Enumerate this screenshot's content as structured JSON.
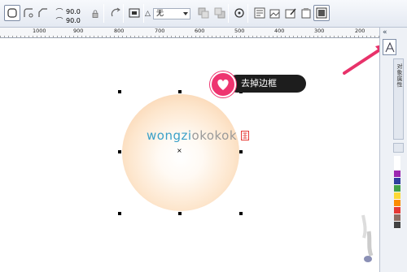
{
  "toolbar": {
    "radius_top": "90.0",
    "radius_bottom": "90.0",
    "outline_prefix": "△",
    "outline_value": "无"
  },
  "ruler": {
    "labels": [
      "1000",
      "900",
      "800",
      "700",
      "600",
      "500",
      "400",
      "300",
      "200"
    ]
  },
  "callout": {
    "text": "去掉边框"
  },
  "watermark": {
    "text_part1": "wongzi",
    "text_part2": "okokok",
    "seal_color": "#e53935"
  },
  "docker": {
    "collapse_glyph": "«",
    "tab_text": "对象属性",
    "palette": [
      "#ffffff",
      "#ffffff",
      "#9c27b0",
      "#303f9f",
      "#43a047",
      "#fdd835",
      "#fb8c00",
      "#e53935",
      "#8d6e63",
      "#424242"
    ]
  },
  "colors": {
    "accent_pink": "#ee3470",
    "arrow_pink": "#e8326a",
    "fill_outer": "#f7c79a"
  }
}
